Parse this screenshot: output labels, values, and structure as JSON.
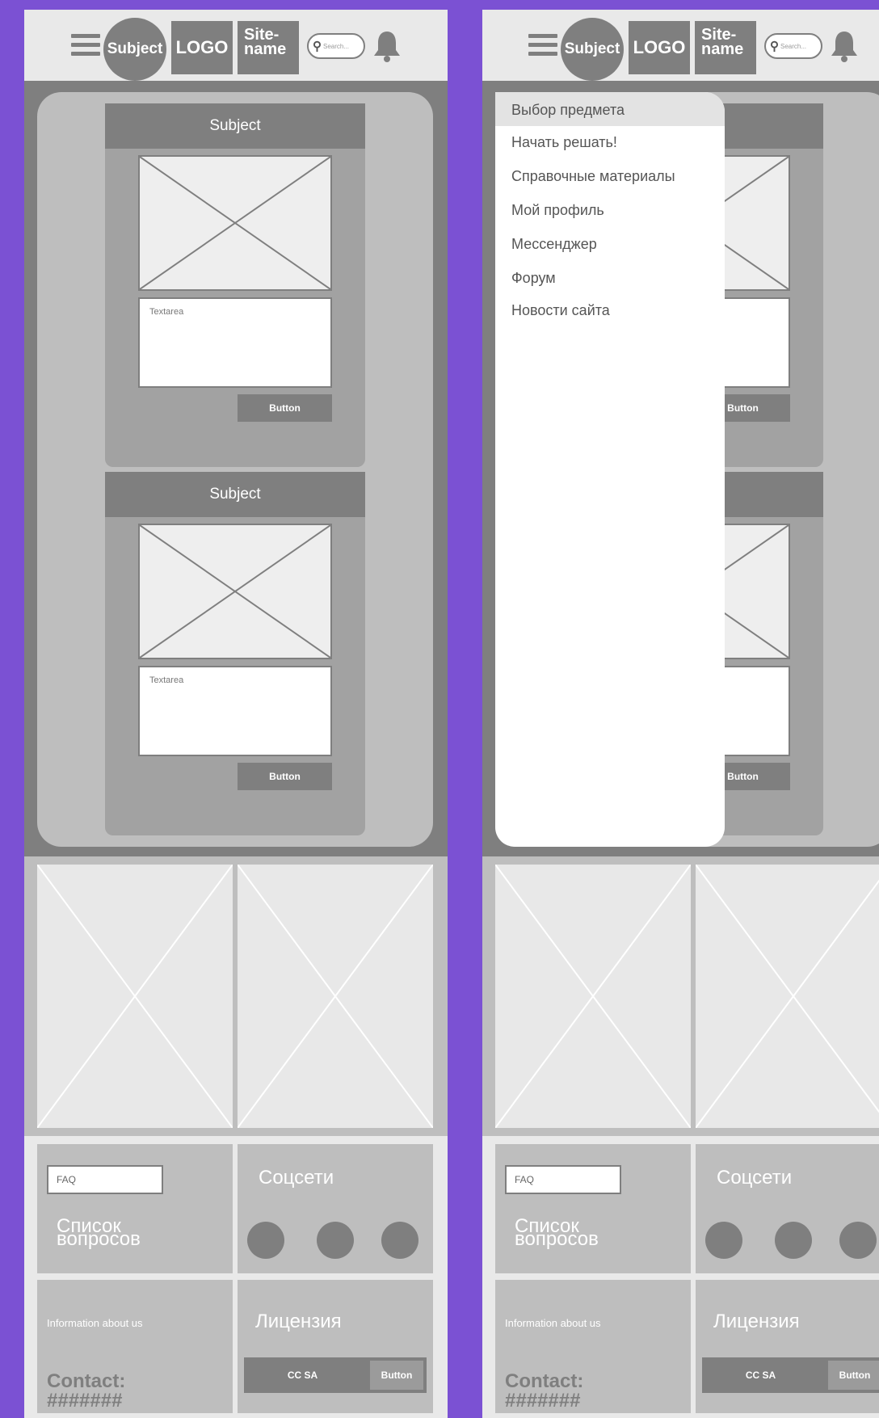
{
  "header": {
    "subject_label": "Subject",
    "logo_label": "LOGO",
    "site_line1": "Site-",
    "site_line2": "name",
    "search_placeholder": "Search..."
  },
  "cards": [
    {
      "title": "Subject",
      "textarea": "Textarea",
      "button": "Button"
    },
    {
      "title": "Subject",
      "textarea": "Textarea",
      "button": "Button"
    }
  ],
  "footer": {
    "faq_field": "FAQ",
    "questions_line1": "Список",
    "questions_line2": "вопросов",
    "social_title": "Соцсети",
    "info_text": "Information about us",
    "contact_label": "Contact:",
    "contact_value": "#######",
    "license_title": "Лицензия",
    "license_value": "CC SA",
    "license_button": "Button"
  },
  "menu": {
    "items": [
      "Выбор предмета",
      "Начать решать!",
      "Справочные материалы",
      "Мой профиль",
      "Мессенджер",
      "Форум",
      "Новости сайта"
    ],
    "selected_index": 0
  },
  "colors": {
    "background": "#7B51D3",
    "dark_gray": "#7f7f7f",
    "mid_gray": "#a2a2a2",
    "light_gray": "#bebebe",
    "header_bg": "#E9E9E9"
  }
}
